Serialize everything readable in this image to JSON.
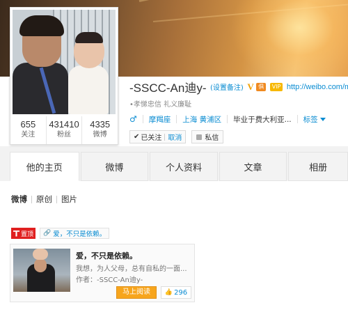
{
  "profile": {
    "username": "-SSCC-An迪y-",
    "remark_link": "(设置备注)",
    "badge_v": "V",
    "badge_club": "俱",
    "badge_vip": "VIP",
    "url": "http://weibo.com/mc",
    "bio": "•孝悌忠信 礼义廉耻",
    "gender_symbol": "♂",
    "zodiac": "摩羯座",
    "location": "上海 黄浦区",
    "education": "毕业于费大利亚...",
    "tags_label": "标签",
    "followed_label": "已关注",
    "unfollow_label": "取消",
    "message_label": "私信"
  },
  "stats": [
    {
      "num": "655",
      "label": "关注"
    },
    {
      "num": "431410",
      "label": "粉丝"
    },
    {
      "num": "4335",
      "label": "微博"
    }
  ],
  "tabs": [
    "他的主页",
    "微博",
    "个人资料",
    "文章",
    "相册"
  ],
  "filters": [
    "微博",
    "原创",
    "图片"
  ],
  "pinned": {
    "badge": "置顶",
    "link_text": "爱，不只是依赖。"
  },
  "article": {
    "title": "爱，不只是依赖。",
    "desc": "我想，为人父母，总有自私的一面...",
    "author": "作者：-SSCC-An迪y-",
    "read_label": "马上阅读",
    "likes": "296"
  },
  "colors": {
    "link_blue": "#0a8cd2",
    "pin_red": "#e02020",
    "read_orange": "#f7a51c",
    "verified_gold": "#f2a000"
  }
}
